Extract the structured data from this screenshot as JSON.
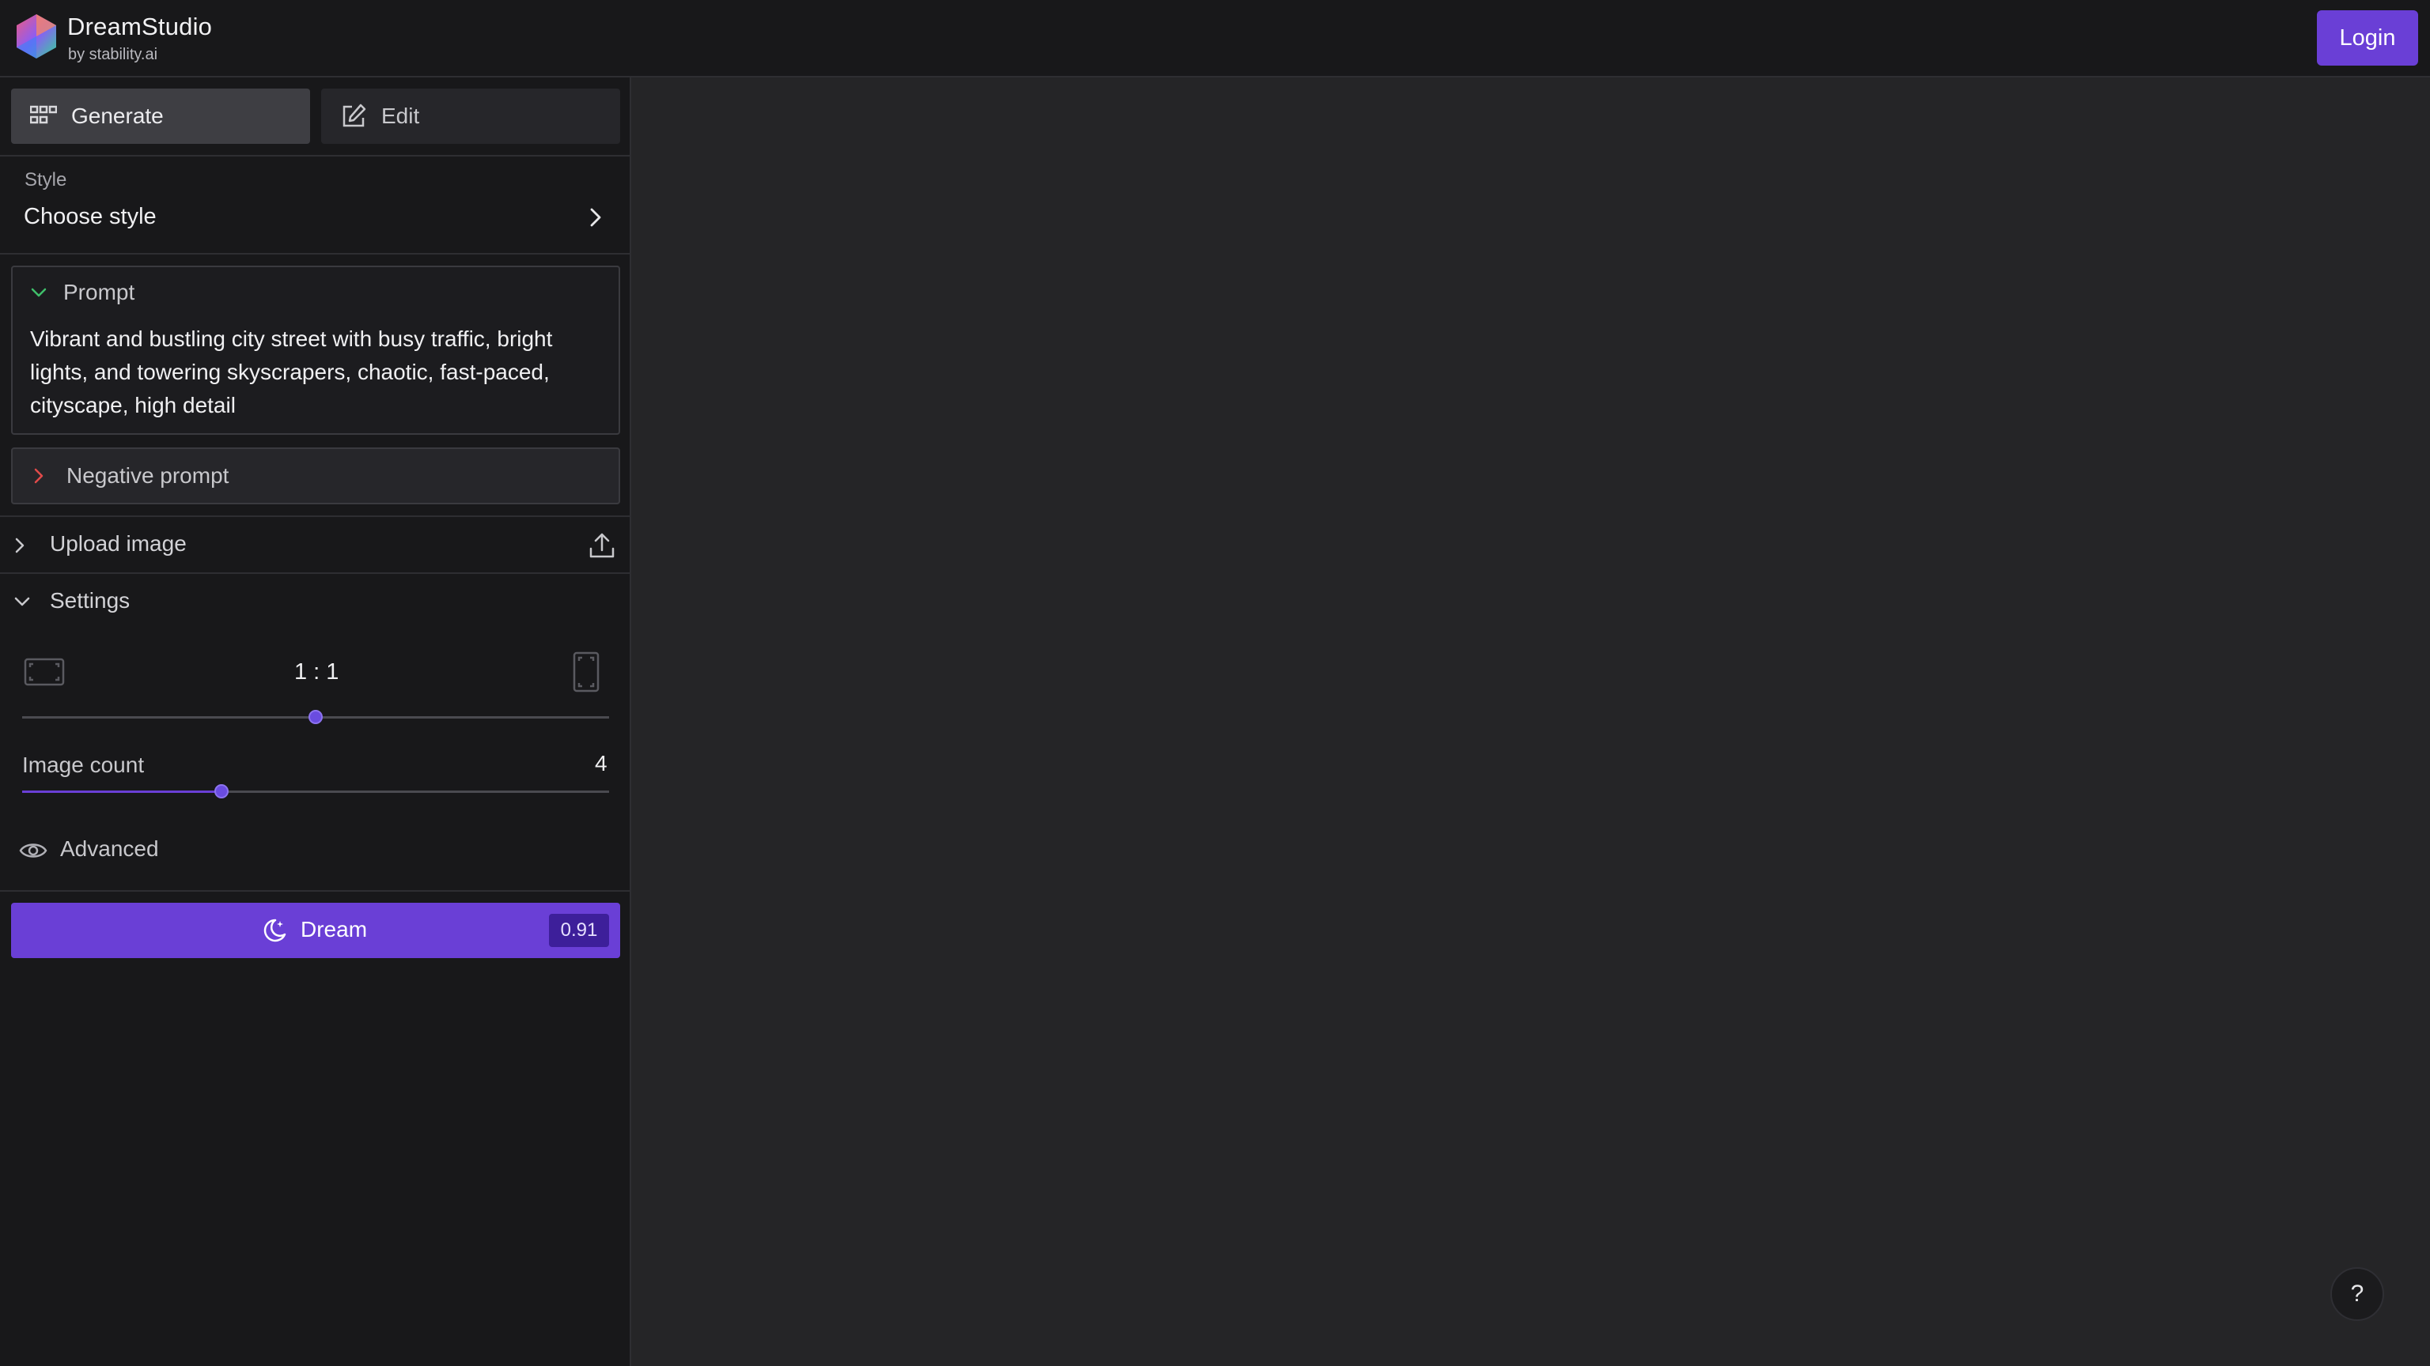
{
  "header": {
    "brand_title": "DreamStudio",
    "brand_subtitle": "by stability.ai",
    "login_label": "Login",
    "logo_icon": "hexagon-gradient-logo"
  },
  "tabs": [
    {
      "label": "Generate",
      "icon": "grid-icon",
      "active": true
    },
    {
      "label": "Edit",
      "icon": "edit-icon",
      "active": false
    }
  ],
  "style": {
    "label": "Style",
    "value": "Choose style"
  },
  "prompt": {
    "label": "Prompt",
    "text": "Vibrant and bustling city street with busy traffic, bright lights, and towering skyscrapers, chaotic, fast-paced, cityscape, high detail",
    "expanded": true
  },
  "negative_prompt": {
    "label": "Negative prompt",
    "expanded": false
  },
  "upload": {
    "label": "Upload image"
  },
  "settings": {
    "label": "Settings",
    "aspect_ratio": "1 : 1",
    "aspect_slider_fraction": 0.5,
    "image_count_label": "Image count",
    "image_count_value": "4",
    "image_count_fraction": 0.34,
    "advanced_label": "Advanced"
  },
  "dream": {
    "label": "Dream",
    "cost": "0.91"
  },
  "help": {
    "label": "?"
  },
  "colors": {
    "accent": "#6a3fd6",
    "sidebar_bg": "#18181a",
    "canvas_bg": "#252527"
  }
}
